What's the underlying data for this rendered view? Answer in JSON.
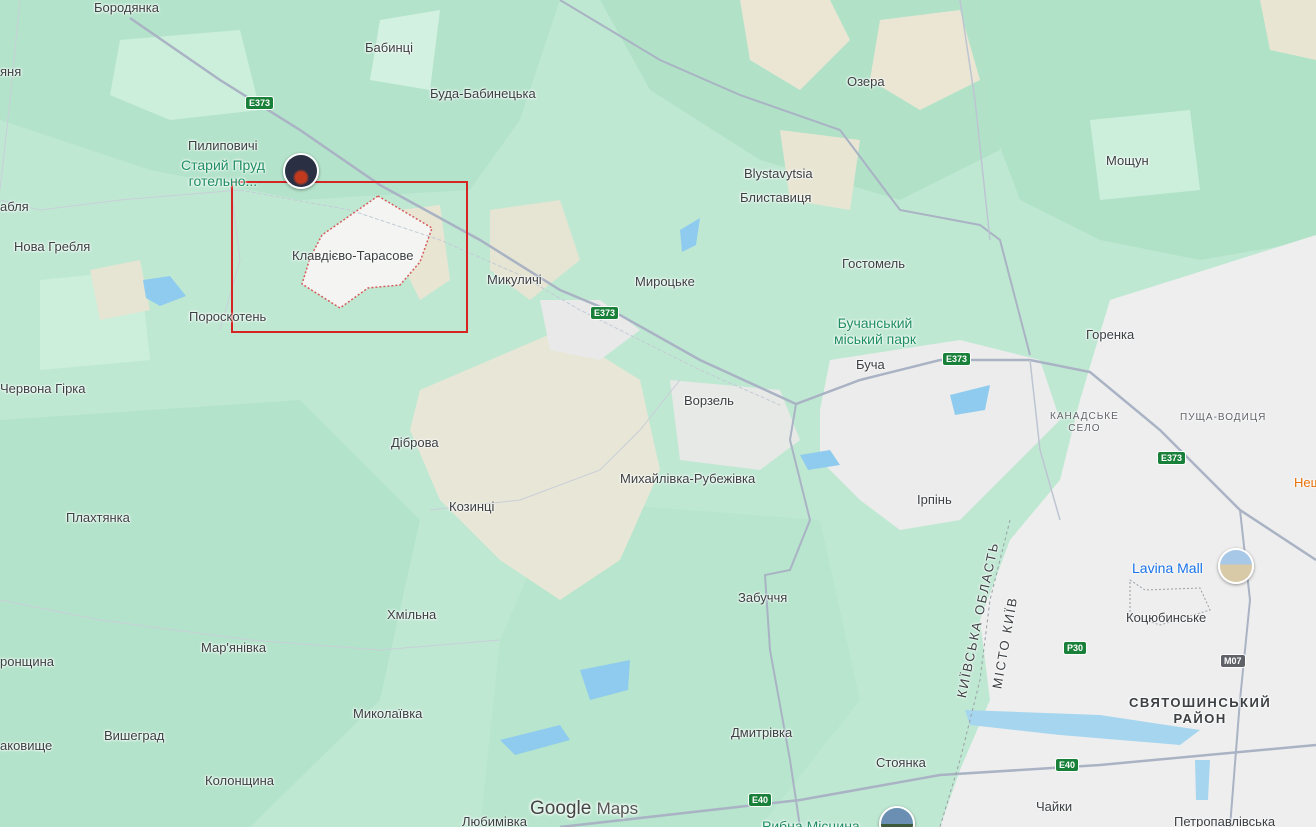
{
  "map": {
    "branding": {
      "google": "Google",
      "maps": "Maps"
    },
    "highlight_color": "#d62323",
    "places": [
      {
        "id": "borodianka",
        "name": "Бородянка"
      },
      {
        "id": "babyntsi",
        "name": "Бабинці"
      },
      {
        "id": "ozera",
        "name": "Озера"
      },
      {
        "id": "buda-babynetska",
        "name": "Буда-Бабинецька"
      },
      {
        "id": "yane",
        "name": "яня"
      },
      {
        "id": "pylypovychi",
        "name": "Пилиповичі"
      },
      {
        "id": "moshchun",
        "name": "Мощун"
      },
      {
        "id": "blystavytsia-lat",
        "name": "Blystavytsia"
      },
      {
        "id": "blystavytsia",
        "name": "Блиставиця"
      },
      {
        "id": "ablia",
        "name": "абля"
      },
      {
        "id": "nova-heblia",
        "name": "Нова Гребля"
      },
      {
        "id": "klavdievo",
        "name": "Клавдієво-Тарасове"
      },
      {
        "id": "hostomel",
        "name": "Гостомель"
      },
      {
        "id": "mykulychi",
        "name": "Микуличі"
      },
      {
        "id": "myrotske",
        "name": "Мироцьке"
      },
      {
        "id": "poroskoten",
        "name": "Пороскотень"
      },
      {
        "id": "horenka",
        "name": "Горенка"
      },
      {
        "id": "bucha",
        "name": "Буча"
      },
      {
        "id": "chervona-hirka",
        "name": "Червона Гірка"
      },
      {
        "id": "vorzel",
        "name": "Ворзель"
      },
      {
        "id": "dibrova",
        "name": "Діброва"
      },
      {
        "id": "mykhailivka",
        "name": "Михайлівка-Рубежівка"
      },
      {
        "id": "irpin",
        "name": "Ірпінь"
      },
      {
        "id": "kozyntsi",
        "name": "Козинці"
      },
      {
        "id": "plakhtianka",
        "name": "Плахтянка"
      },
      {
        "id": "zabuchchia",
        "name": "Забуччя"
      },
      {
        "id": "kotsiubynske",
        "name": "Коцюбинське"
      },
      {
        "id": "khmilna",
        "name": "Хмільна"
      },
      {
        "id": "marianivka",
        "name": "Мар'янівка"
      },
      {
        "id": "ronshchyna",
        "name": "ронщина"
      },
      {
        "id": "mykolaivka",
        "name": "Миколаївка"
      },
      {
        "id": "dmytrivka",
        "name": "Дмитрівка"
      },
      {
        "id": "vyshehrad",
        "name": "Вишеград"
      },
      {
        "id": "akovyshche",
        "name": "аковище"
      },
      {
        "id": "stoianka",
        "name": "Стоянка"
      },
      {
        "id": "kolonshchyna",
        "name": "Колонщина"
      },
      {
        "id": "chaiky",
        "name": "Чайки"
      },
      {
        "id": "liubymivka",
        "name": "Любимівка"
      },
      {
        "id": "petropavlivska",
        "name": "Петропавлівська"
      }
    ],
    "small_labels": {
      "kanadske": "КАНАДСЬКЕ\nСЕЛО",
      "pushcha": "ПУЩА-ВОДИЦЯ"
    },
    "district": "СВЯТОШИНСЬКИЙ\nРАЙОН",
    "admin_labels": {
      "oblast": "КИЇВСЬКА ОБЛАСТЬ",
      "city": "МІСТО КИЇВ"
    },
    "pois": {
      "staryi_prud": "Старий Пруд\nготельно...",
      "bucha_park": "Бучанський\nміський парк",
      "lavina_mall": "Lavina Mall",
      "rybna": "Рибна Місцина",
      "nesh": "Неш"
    },
    "road_shields": [
      {
        "id": "e373-a",
        "label": "E373",
        "style": "green"
      },
      {
        "id": "e373-b",
        "label": "E373",
        "style": "green"
      },
      {
        "id": "e373-c",
        "label": "E373",
        "style": "green"
      },
      {
        "id": "e373-d",
        "label": "E373",
        "style": "green"
      },
      {
        "id": "p30",
        "label": "P30",
        "style": "green"
      },
      {
        "id": "m07",
        "label": "M07",
        "style": "grey"
      },
      {
        "id": "e40-a",
        "label": "E40",
        "style": "green"
      },
      {
        "id": "e40-b",
        "label": "E40",
        "style": "green"
      }
    ]
  }
}
